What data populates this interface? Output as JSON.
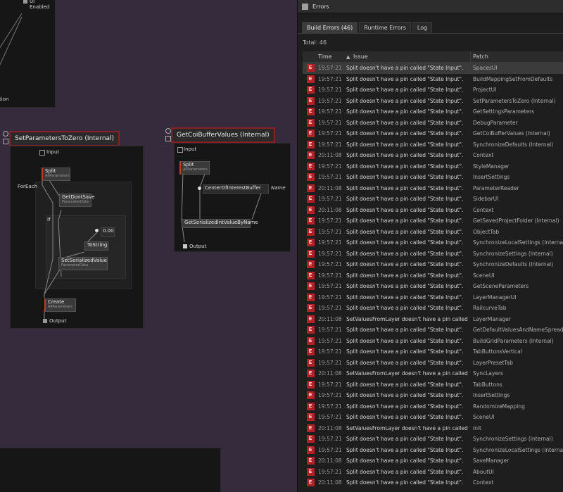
{
  "canvas": {
    "top_left_label": "UI Enabled",
    "top_left_tail": "tion",
    "node_set_params": {
      "title": "SetParametersToZero (Internal)",
      "input": "Input",
      "split": "Split",
      "split_sub": "AllParameters",
      "foreach": "ForEach",
      "getdontsave": "GetDontSave",
      "getdontsave_sub": "ParameterData",
      "if": "If",
      "value": "0.00",
      "tostring": "ToString",
      "setserialized": "SetSerializedValue",
      "setserialized_sub": "ParameterData",
      "create": "Create",
      "create_sub": "AllParameters",
      "output": "Output"
    },
    "node_get_coi": {
      "title": "GetCoiBufferValues (Internal)",
      "input": "Input",
      "split": "Split",
      "split_sub": "AllParameters",
      "center": "CenterOfInterestBuffer",
      "name": "Name",
      "getserialized": "GetSerializedIntValueByName",
      "output": "Output"
    }
  },
  "errors_window": {
    "title": "Errors",
    "tabs": [
      "Build Errors (46)",
      "Runtime Errors",
      "Log"
    ],
    "total": "Total: 46",
    "columns": {
      "time": "Time",
      "issue": "Issue",
      "patch": "Patch"
    },
    "rows": [
      {
        "time": "19:57:21",
        "issue": "Split doesn't have a pin called \"State Input\".",
        "patch": "SpacesUI"
      },
      {
        "time": "19:57:21",
        "issue": "Split doesn't have a pin called \"State Input\".",
        "patch": "BuildMappingSetFromDefaults"
      },
      {
        "time": "19:57:21",
        "issue": "Split doesn't have a pin called \"State Input\".",
        "patch": "ProjectUI"
      },
      {
        "time": "19:57:21",
        "issue": "Split doesn't have a pin called \"State Input\".",
        "patch": "SetParametersToZero (Internal)"
      },
      {
        "time": "19:57:21",
        "issue": "Split doesn't have a pin called \"State Input\".",
        "patch": "GetSettingsParameters"
      },
      {
        "time": "19:57:21",
        "issue": "Split doesn't have a pin called \"State Input\".",
        "patch": "DebugParameter"
      },
      {
        "time": "19:57:21",
        "issue": "Split doesn't have a pin called \"State Input\".",
        "patch": "GetCoiBufferValues (Internal)"
      },
      {
        "time": "19:57:21",
        "issue": "Split doesn't have a pin called \"State Input\".",
        "patch": "SynchronizeDefaults (Internal)"
      },
      {
        "time": "20:11:08",
        "issue": "Split doesn't have a pin called \"State Input\".",
        "patch": "Context"
      },
      {
        "time": "19:57:21",
        "issue": "Split doesn't have a pin called \"State Input\".",
        "patch": "StyleManager"
      },
      {
        "time": "19:57:21",
        "issue": "Split doesn't have a pin called \"State Input\".",
        "patch": "InsertSettings"
      },
      {
        "time": "20:11:08",
        "issue": "Split doesn't have a pin called \"State Input\".",
        "patch": "ParameterReader"
      },
      {
        "time": "19:57:21",
        "issue": "Split doesn't have a pin called \"State Input\".",
        "patch": "SidebarUI"
      },
      {
        "time": "20:11:08",
        "issue": "Split doesn't have a pin called \"State Input\".",
        "patch": "Context"
      },
      {
        "time": "19:57:21",
        "issue": "Split doesn't have a pin called \"State Input\".",
        "patch": "GetSavedProjectFolder (Internal)"
      },
      {
        "time": "19:57:21",
        "issue": "Split doesn't have a pin called \"State Input\".",
        "patch": "ObjectTab"
      },
      {
        "time": "19:57:21",
        "issue": "Split doesn't have a pin called \"State Input\".",
        "patch": "SynchronizeLocalSettings (Internal)"
      },
      {
        "time": "19:57:21",
        "issue": "Split doesn't have a pin called \"State Input\".",
        "patch": "SynchronizeSettings (Internal)"
      },
      {
        "time": "19:57:21",
        "issue": "Split doesn't have a pin called \"State Input\".",
        "patch": "SynchronizeDefaults (Internal)"
      },
      {
        "time": "19:57:21",
        "issue": "Split doesn't have a pin called \"State Input\".",
        "patch": "SceneUI"
      },
      {
        "time": "19:57:21",
        "issue": "Split doesn't have a pin called \"State Input\".",
        "patch": "GetSceneParameters"
      },
      {
        "time": "19:57:21",
        "issue": "Split doesn't have a pin called \"State Input\".",
        "patch": "LayerManagerUI"
      },
      {
        "time": "19:57:21",
        "issue": "Split doesn't have a pin called \"State Input\".",
        "patch": "RailcurveTab"
      },
      {
        "time": "20:11:08",
        "issue": "SetValuesFromLayer doesn't have a pin called \"Stat",
        "patch": "LayerManager"
      },
      {
        "time": "19:57:21",
        "issue": "Split doesn't have a pin called \"State Input\".",
        "patch": "GetDefaultValuesAndNameSpread"
      },
      {
        "time": "19:57:21",
        "issue": "Split doesn't have a pin called \"State Input\".",
        "patch": "BuildGridParameters (Internal)"
      },
      {
        "time": "19:57:21",
        "issue": "Split doesn't have a pin called \"State Input\".",
        "patch": "TabButtonsVertical"
      },
      {
        "time": "19:57:21",
        "issue": "Split doesn't have a pin called \"State Input\".",
        "patch": "LayerPresetTab"
      },
      {
        "time": "20:11:08",
        "issue": "SetValuesFromLayer doesn't have a pin called \"Stat",
        "patch": "SyncLayers"
      },
      {
        "time": "19:57:21",
        "issue": "Split doesn't have a pin called \"State Input\".",
        "patch": "TabButtons"
      },
      {
        "time": "19:57:21",
        "issue": "Split doesn't have a pin called \"State Input\".",
        "patch": "InsertSettings"
      },
      {
        "time": "19:57:21",
        "issue": "Split doesn't have a pin called \"State Input\".",
        "patch": "RandomizeMapping"
      },
      {
        "time": "19:57:21",
        "issue": "Split doesn't have a pin called \"State Input\".",
        "patch": "SceneUI"
      },
      {
        "time": "20:11:08",
        "issue": "SetValuesFromLayer doesn't have a pin called \"Stat",
        "patch": "Init"
      },
      {
        "time": "19:57:21",
        "issue": "Split doesn't have a pin called \"State Input\".",
        "patch": "SynchronizeSettings (Internal)"
      },
      {
        "time": "19:57:21",
        "issue": "Split doesn't have a pin called \"State Input\".",
        "patch": "SynchronizeLocalSettings (Internal)"
      },
      {
        "time": "20:11:08",
        "issue": "Split doesn't have a pin called \"State Input\".",
        "patch": "SaveManager"
      },
      {
        "time": "19:57:21",
        "issue": "Split doesn't have a pin called \"State Input\".",
        "patch": "AboutUI"
      },
      {
        "time": "20:11:08",
        "issue": "Split doesn't have a pin called \"State Input\".",
        "patch": "Context"
      }
    ]
  }
}
